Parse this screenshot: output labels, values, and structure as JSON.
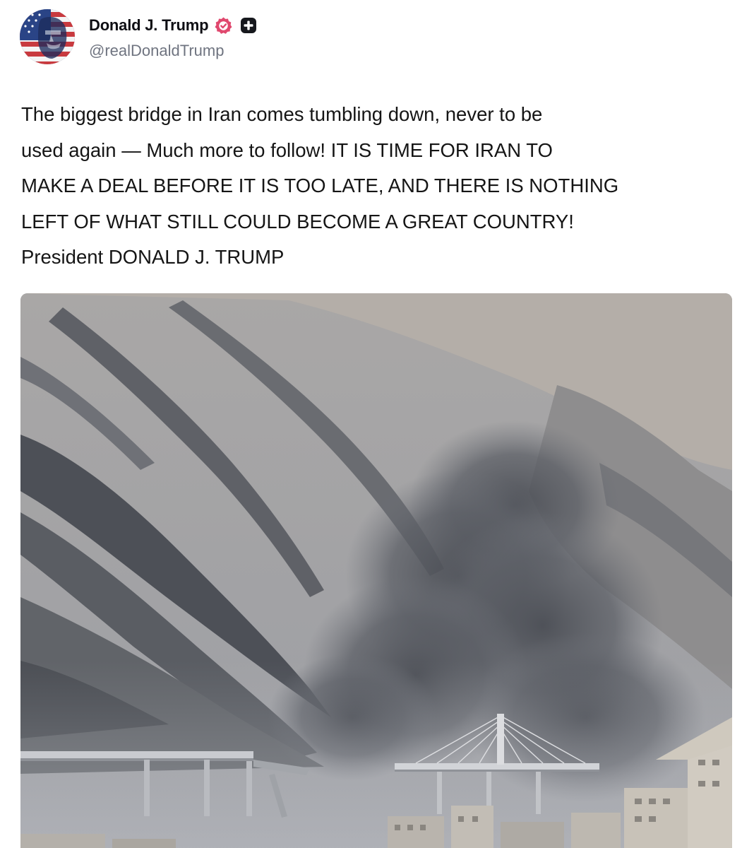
{
  "author": {
    "display_name": "Donald J. Trump",
    "handle": "@realDonaldTrump",
    "avatar_icon": "american-flag-portrait-avatar",
    "verified_icon": "verified-badge-icon",
    "plus_icon": "plus-badge-icon"
  },
  "post": {
    "text_lines": [
      "The biggest bridge in Iran comes tumbling down, never to be",
      "used again — Much more to follow! IT IS TIME FOR IRAN TO",
      "MAKE A DEAL BEFORE IT IS TOO LATE, AND THERE IS NOTHING",
      "LEFT OF WHAT STILL COULD BECOME A GREAT COUNTRY!",
      "President DONALD J. TRUMP"
    ]
  },
  "media": {
    "type": "video-still",
    "subject": "bridge-collapse-smoke-mountains"
  },
  "colors": {
    "verified": "#e0486e",
    "handle": "#6f7480",
    "text": "#151515"
  }
}
